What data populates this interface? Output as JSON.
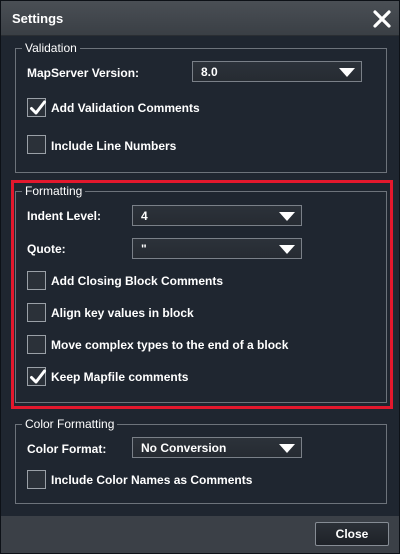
{
  "window": {
    "title": "Settings"
  },
  "validation": {
    "legend": "Validation",
    "mapserver_label": "MapServer Version:",
    "mapserver_value": "8.0",
    "add_comments_label": "Add Validation Comments",
    "add_comments_checked": true,
    "line_numbers_label": "Include Line Numbers",
    "line_numbers_checked": false
  },
  "formatting": {
    "legend": "Formatting",
    "indent_label": "Indent Level:",
    "indent_value": "4",
    "quote_label": "Quote:",
    "quote_value": "\"",
    "options": [
      {
        "label": "Add Closing Block Comments",
        "checked": false
      },
      {
        "label": "Align key values in block",
        "checked": false
      },
      {
        "label": "Move complex types to the end of a block",
        "checked": false
      },
      {
        "label": "Keep Mapfile comments",
        "checked": true
      }
    ]
  },
  "color_formatting": {
    "legend": "Color Formatting",
    "format_label": "Color Format:",
    "format_value": "No Conversion",
    "names_label": "Include Color Names as Comments",
    "names_checked": false
  },
  "footer": {
    "close_label": "Close"
  },
  "colors": {
    "highlight": "#e3182d",
    "background": "#1f2630"
  }
}
